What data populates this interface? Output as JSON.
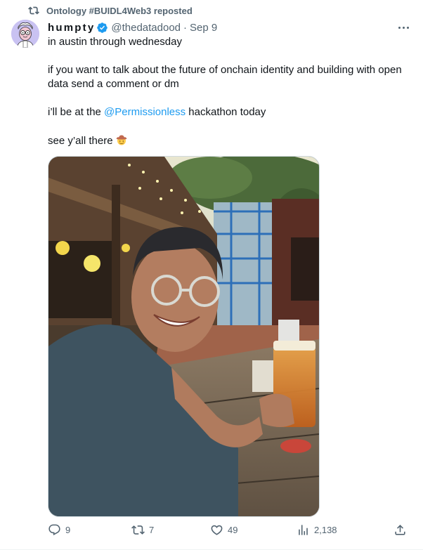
{
  "repost": {
    "text": "Ontology #BUIDL4Web3 reposted",
    "icon": "repost-icon"
  },
  "author": {
    "display_name": "humpty",
    "handle": "@thedatadood",
    "separator": "·",
    "time": "Sep 9",
    "verified_color": "#1d9bf0"
  },
  "tweet": {
    "line1": "in austin through wednesday",
    "line2": "if you want to talk about the future of onchain identity and building with open data send a comment or dm",
    "line3_prefix": "i’ll be at the ",
    "line3_mention": "@Permissionless",
    "line3_suffix": " hackathon today",
    "line4": "see y’all there",
    "emoji": "cowboy-face-emoji"
  },
  "actions": {
    "replies": "9",
    "reposts": "7",
    "likes": "49",
    "views": "2,138"
  },
  "colors": {
    "accent": "#1d9bf0",
    "secondary_text": "#536471",
    "primary_text": "#0f1419"
  }
}
